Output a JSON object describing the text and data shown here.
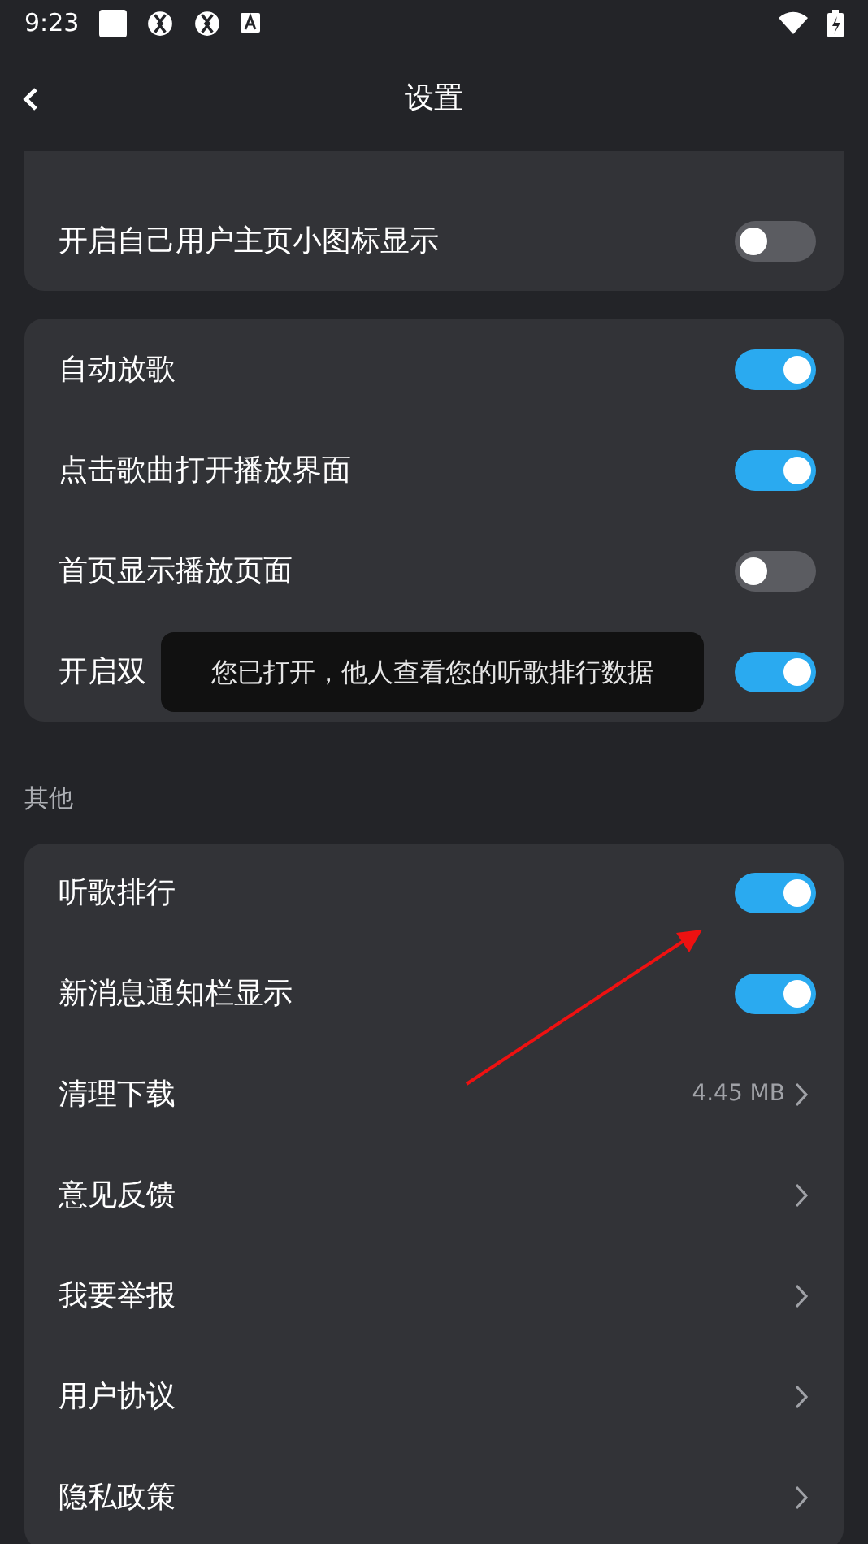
{
  "status_bar": {
    "time": "9:23"
  },
  "header": {
    "title": "设置"
  },
  "groups": [
    {
      "rows": [
        {
          "kind": "toggle",
          "label": "开启自己用户主页小图标显示",
          "on": false
        }
      ]
    },
    {
      "rows": [
        {
          "kind": "toggle",
          "label": "自动放歌",
          "on": true
        },
        {
          "kind": "toggle",
          "label": "点击歌曲打开播放界面",
          "on": true
        },
        {
          "kind": "toggle",
          "label": "首页显示播放页面",
          "on": false
        },
        {
          "kind": "toggle",
          "label": "开启双",
          "on": true
        }
      ]
    },
    {
      "title": "其他",
      "rows": [
        {
          "kind": "toggle",
          "label": "听歌排行",
          "on": true
        },
        {
          "kind": "toggle",
          "label": "新消息通知栏显示",
          "on": true
        },
        {
          "kind": "link",
          "label": "清理下载",
          "value": "4.45 MB"
        },
        {
          "kind": "link",
          "label": "意见反馈"
        },
        {
          "kind": "link",
          "label": "我要举报"
        },
        {
          "kind": "link",
          "label": "用户协议"
        },
        {
          "kind": "link",
          "label": "隐私政策"
        }
      ]
    }
  ],
  "toast": {
    "text": "您已打开，他人查看您的听歌排行数据"
  }
}
